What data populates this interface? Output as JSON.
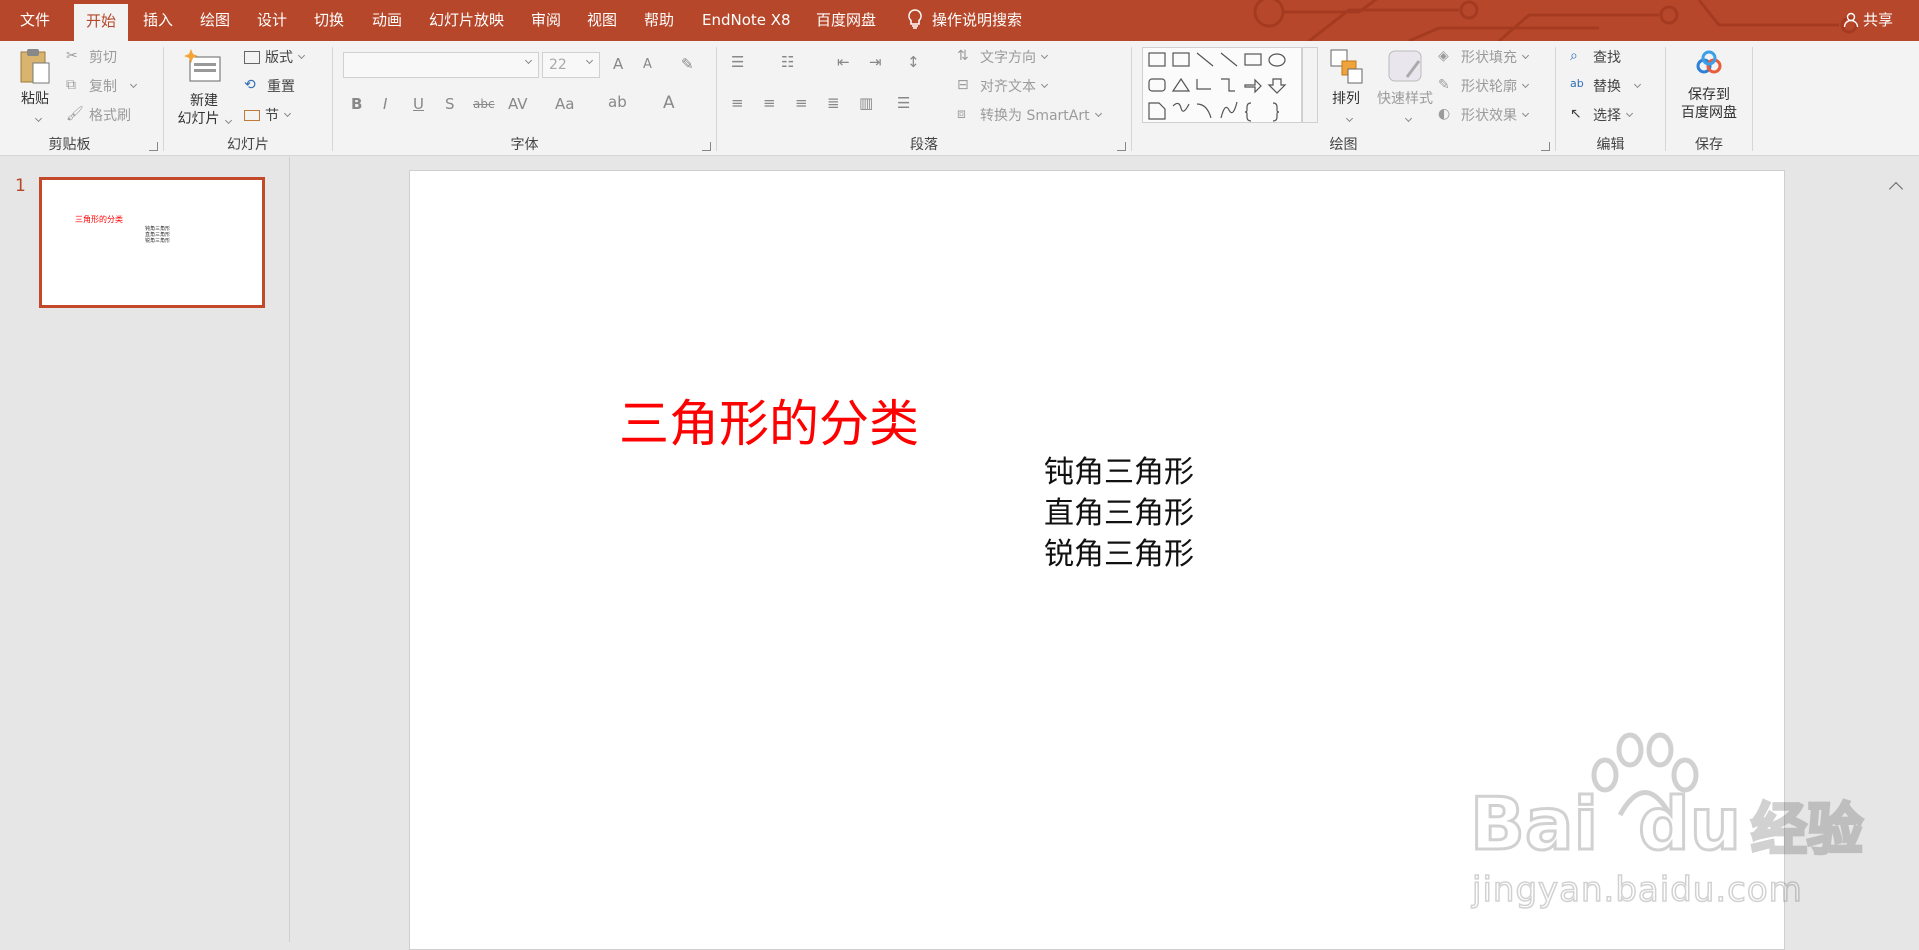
{
  "menu_tabs": [
    "文件",
    "开始",
    "插入",
    "绘图",
    "设计",
    "切换",
    "动画",
    "幻灯片放映",
    "审阅",
    "视图",
    "帮助",
    "EndNote X8",
    "百度网盘"
  ],
  "tell_me": "操作说明搜索",
  "share": "共享",
  "clipboard": {
    "paste": "粘贴",
    "cut": "剪切",
    "copy": "复制",
    "format_painter": "格式刷",
    "group": "剪贴板"
  },
  "slides_group": {
    "new_slide_line1": "新建",
    "new_slide_line2": "幻灯片",
    "layout": "版式",
    "reset": "重置",
    "section": "节",
    "group": "幻灯片"
  },
  "font": {
    "size": "22",
    "bold": "B",
    "italic": "I",
    "underline": "U",
    "shadow": "S",
    "strike": "abc",
    "spacing": "AV",
    "case": "Aa",
    "color": "A",
    "grow": "A",
    "shrink": "A",
    "group": "字体"
  },
  "paragraph": {
    "text_direction": "文字方向",
    "align_text": "对齐文本",
    "smartart": "转换为 SmartArt",
    "group": "段落"
  },
  "drawing": {
    "arrange": "排列",
    "quick_styles": "快速样式",
    "shape_fill": "形状填充",
    "shape_outline": "形状轮廓",
    "shape_effects": "形状效果",
    "group": "绘图"
  },
  "editing": {
    "find": "查找",
    "replace": "替换",
    "select": "选择",
    "group": "编辑"
  },
  "save": {
    "line1": "保存到",
    "line2": "百度网盘",
    "group": "保存"
  },
  "thumbnail": {
    "number": "1",
    "title": "三角形的分类",
    "lines": [
      "钝角三角形",
      "直角三角形",
      "锐角三角形"
    ]
  },
  "slide": {
    "title": "三角形的分类",
    "lines": [
      "钝角三角形",
      "直角三角形",
      "锐角三角形"
    ]
  },
  "watermark": {
    "brand": "Bai",
    "brand2": "du",
    "suffix": "经验",
    "url": "jingyan.baidu.com"
  },
  "colors": {
    "accent": "#b7472a",
    "title_red": "#ff0000"
  }
}
